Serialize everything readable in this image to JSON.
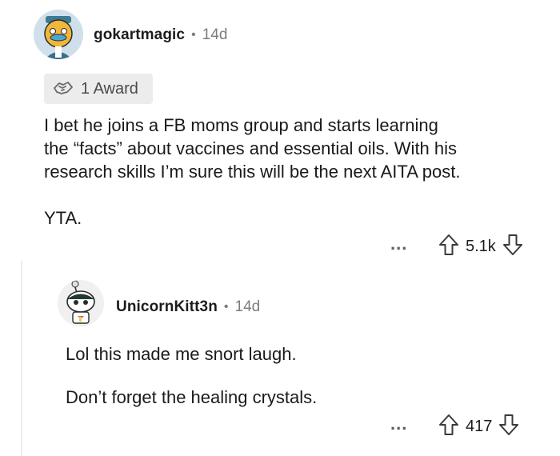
{
  "comment": {
    "username": "gokartmagic",
    "separator": "•",
    "time": "14d",
    "award": {
      "label": "1 Award",
      "icon": "award-icon"
    },
    "paragraphs": [
      "I bet he joins a FB moms group and starts learning",
      "the “facts” about vaccines and essential oils. With his",
      "research skills I’m sure this will be the next AITA post."
    ],
    "paragraph2": "YTA.",
    "more": "...",
    "votes": "5.1k"
  },
  "reply": {
    "username": "UnicornKitt3n",
    "separator": "•",
    "time": "14d",
    "line1": "Lol this made me snort laugh.",
    "line2": "Don’t forget the healing crystals.",
    "more": "...",
    "votes": "417"
  }
}
